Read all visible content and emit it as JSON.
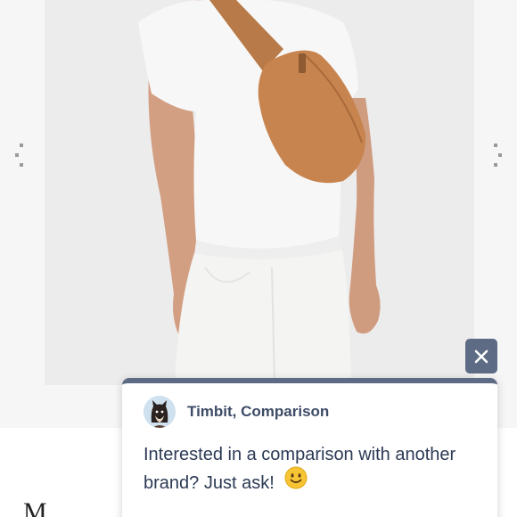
{
  "product": {
    "image_subject": "tan leather hip pack worn crossbody"
  },
  "gallery": {
    "prev_icon": "dotted-chevron-left-icon",
    "next_icon": "dotted-chevron-right-icon"
  },
  "chat": {
    "close_icon": "close-icon",
    "sender": "Timbit, Comparison",
    "message": "Interested in a comparison with another brand? Just ask!",
    "emoji": "🙂",
    "accent_color": "#5d6b85"
  },
  "below_fold": {
    "title_fragment": "M"
  }
}
